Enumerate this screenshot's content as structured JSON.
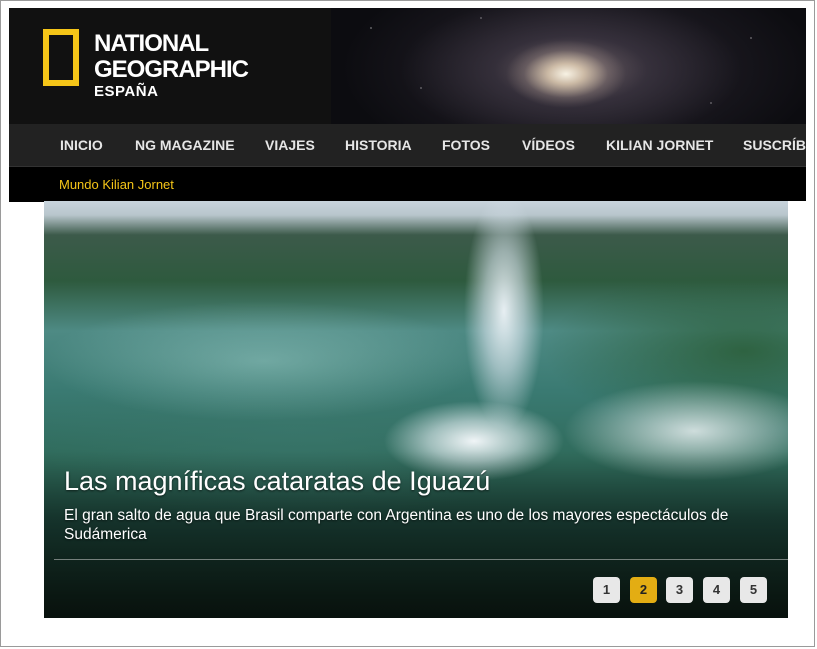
{
  "brand": {
    "line1": "NATIONAL",
    "line2": "GEOGRAPHIC",
    "line3": "ESPAÑA",
    "accent": "#f5c518"
  },
  "nav": {
    "items": [
      {
        "label": "INICIO"
      },
      {
        "label": "NG MAGAZINE"
      },
      {
        "label": "VIAJES"
      },
      {
        "label": "HISTORIA"
      },
      {
        "label": "FOTOS"
      },
      {
        "label": "VÍDEOS"
      },
      {
        "label": "KILIAN JORNET"
      },
      {
        "label": "SUSCRÍB"
      }
    ]
  },
  "subnav": {
    "link": "Mundo Kilian Jornet"
  },
  "hero": {
    "title": "Las magníficas cataratas de Iguazú",
    "description": "El gran salto de agua que Brasil comparte con Argentina es uno de los mayores espectáculos de Sudámerica"
  },
  "pager": {
    "pages": [
      "1",
      "2",
      "3",
      "4",
      "5"
    ],
    "active": "2",
    "active_color": "#e3ad13"
  }
}
